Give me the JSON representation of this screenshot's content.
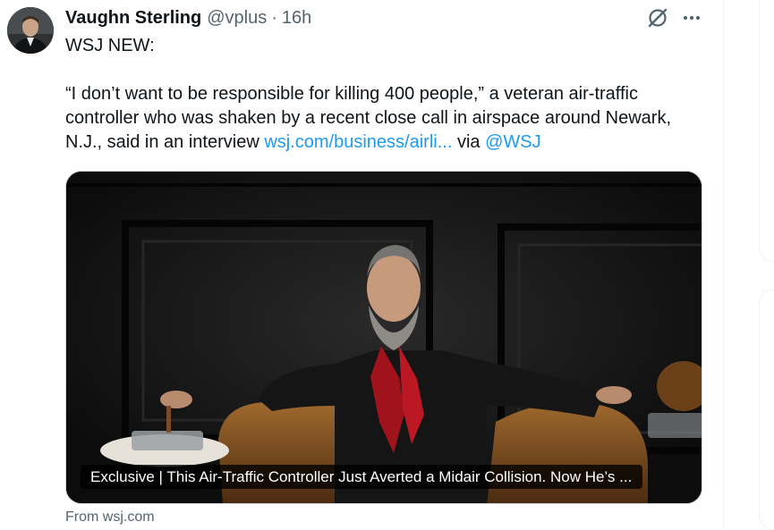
{
  "tweet": {
    "author_name": "Vaughn Sterling",
    "handle": "@vplus",
    "separator": "·",
    "time": "16h",
    "line1": "WSJ NEW:",
    "body_text": "“I don’t want to be responsible for killing 400 people,” a veteran air-traffic controller who was shaken by a recent close call in airspace around Newark, N.J., said in an interview ",
    "link_text": "wsj.com/business/airli...",
    "via_text": " via ",
    "mention": "@WSJ"
  },
  "icons": {
    "grok": "grok-icon",
    "more": "more-icon"
  },
  "card": {
    "title": "Exclusive | This Air-Traffic Controller Just Averted a Midair Collision. Now He’s ...",
    "source": "From wsj.com"
  },
  "colors": {
    "link": "#1d9bf0",
    "secondary_text": "#536471",
    "primary_text": "#0f1419"
  }
}
